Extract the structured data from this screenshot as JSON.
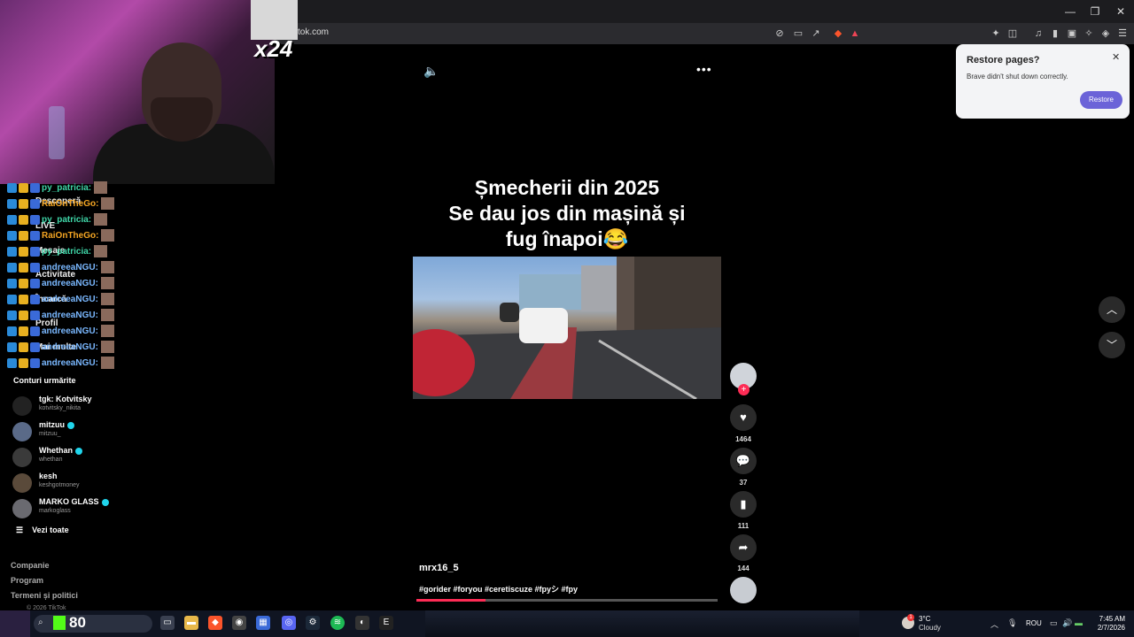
{
  "browser": {
    "url": "tok.com",
    "window_controls": [
      "—",
      "❐",
      "✕"
    ]
  },
  "stream_overlay": {
    "multiplier": "x24",
    "chat": [
      {
        "user": "py_patricia:",
        "color": "#3fd6a8"
      },
      {
        "user": "RaiOnTheGo:",
        "color": "#f5a623"
      },
      {
        "user": "py_patricia:",
        "color": "#3fd6a8"
      },
      {
        "user": "RaiOnTheGo:",
        "color": "#f5a623"
      },
      {
        "user": "py_patricia:",
        "color": "#3fd6a8"
      },
      {
        "user": "andreeaNGU:",
        "color": "#7ab8ff"
      },
      {
        "user": "andreeaNGU:",
        "color": "#7ab8ff"
      },
      {
        "user": "andreeaNGU:",
        "color": "#7ab8ff"
      },
      {
        "user": "andreeaNGU:",
        "color": "#7ab8ff"
      },
      {
        "user": "andreeaNGU:",
        "color": "#7ab8ff"
      },
      {
        "user": "andreeaNGU:",
        "color": "#7ab8ff"
      },
      {
        "user": "andreeaNGU:",
        "color": "#7ab8ff"
      }
    ]
  },
  "sidebar": {
    "partial_items": [
      "Descoperă",
      "LIVE",
      "Mesaje",
      "Activitate",
      "Încarcă",
      "Profil",
      "Mai multe"
    ],
    "followed_title": "Conturi urmărite",
    "accounts": [
      {
        "name": "tgk: Kotvitsky",
        "handle": "kotvitsky_nikita",
        "verified": false
      },
      {
        "name": "mitzuu",
        "handle": "mitzuu_",
        "verified": true
      },
      {
        "name": "Whethan",
        "handle": "whethan",
        "verified": true
      },
      {
        "name": "kesh",
        "handle": "keshgotmoney",
        "verified": false
      },
      {
        "name": "MARKO GLASS",
        "handle": "markoglass",
        "verified": true
      }
    ],
    "see_all": "Vezi toate",
    "footer_links": [
      "Companie",
      "Program",
      "Termeni și politici"
    ],
    "copyright": "© 2026 TikTok"
  },
  "video": {
    "caption_lines": [
      "Șmecherii din 2025",
      "Se dau jos din mașină și",
      "fug înapoi😂"
    ],
    "author": "mrx16_5",
    "hashtags": "#gorider #foryou #ceretiscuze #fpyシ #fpy",
    "progress": 0.23,
    "sound_icon": "speaker-icon",
    "more_icon": "ellipsis-icon"
  },
  "actions": {
    "likes": "1464",
    "comments": "37",
    "saves": "111",
    "shares": "144"
  },
  "restore_popup": {
    "title": "Restore pages?",
    "message": "Brave didn't shut down correctly.",
    "button": "Restore"
  },
  "taskbar": {
    "kick_score": "80",
    "weather_temp": "3°C",
    "weather_desc": "Cloudy",
    "weather_badge": "1",
    "language": "ROU",
    "time": "7:45 AM",
    "date": "2/7/2026"
  },
  "colors": {
    "accent": "#fe2c55",
    "restore_button": "#6b63d8",
    "verified": "#20d5ec"
  }
}
